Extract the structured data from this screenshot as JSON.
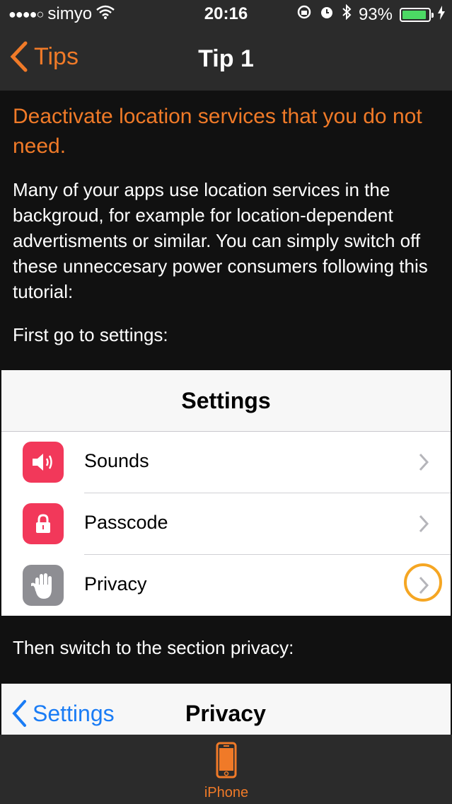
{
  "status_bar": {
    "signal_dots": "●●●●○",
    "carrier": "simyo",
    "time": "20:16",
    "battery_percent": "93%",
    "battery_level": 0.93,
    "icons": [
      "wifi-icon",
      "rotation-lock-icon",
      "alarm-icon",
      "bluetooth-icon",
      "battery-icon",
      "charging-icon"
    ]
  },
  "nav": {
    "back_label": "Tips",
    "title": "Tip 1"
  },
  "content": {
    "headline": "Deactivate location services that you do not need.",
    "paragraph": "Many of your apps use location services in the backgroud, for example for location-dependent advertisments or similar. You can simply switch off these unneccesary power consumers following this tutorial:",
    "step1": "First go to settings:",
    "step2": "Then switch to the section privacy:"
  },
  "settings_panel": {
    "title": "Settings",
    "rows": [
      {
        "label": "Sounds",
        "icon": "speaker-icon",
        "color": "#f2385a"
      },
      {
        "label": "Passcode",
        "icon": "lock-icon",
        "color": "#f2385a"
      },
      {
        "label": "Privacy",
        "icon": "hand-icon",
        "color": "#8e8e93",
        "highlighted": true
      }
    ]
  },
  "privacy_panel": {
    "back_label": "Settings",
    "title": "Privacy"
  },
  "tabbar": {
    "items": [
      {
        "label": "iPhone",
        "icon": "iphone-icon"
      }
    ]
  },
  "colors": {
    "accent": "#f07a28",
    "ios_blue": "#1a7cf5",
    "highlight_ring": "#f5a623",
    "battery_green": "#4cd964"
  }
}
